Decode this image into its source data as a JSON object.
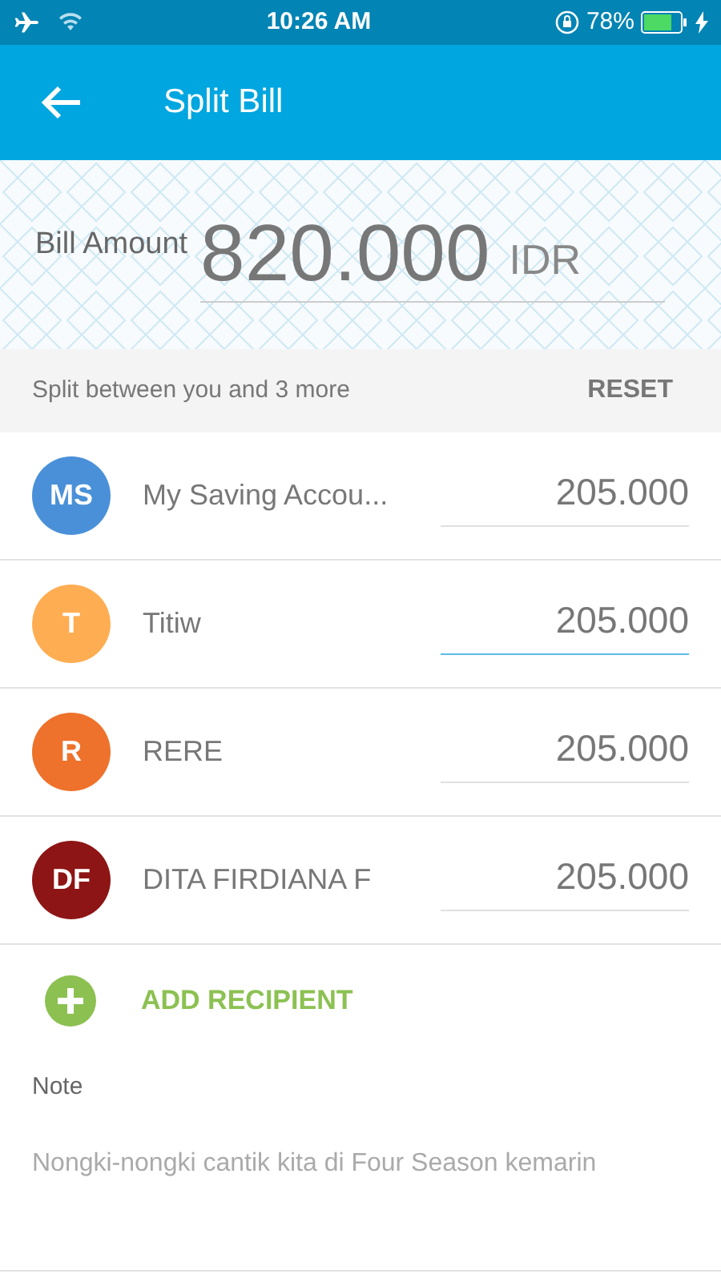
{
  "status_bar": {
    "time": "10:26 AM",
    "battery": "78%"
  },
  "header": {
    "title": "Split Bill"
  },
  "bill": {
    "label": "Bill Amount",
    "amount": "820.000",
    "currency": "IDR"
  },
  "split": {
    "summary": "Split between you and 3 more",
    "reset": "RESET"
  },
  "recipients": [
    {
      "initials": "MS",
      "name": "My Saving Accou...",
      "amount": "205.000",
      "color": "#4a90d9",
      "focused": false
    },
    {
      "initials": "T",
      "name": "Titiw",
      "amount": "205.000",
      "color": "#ffad52",
      "focused": true
    },
    {
      "initials": "R",
      "name": "RERE",
      "amount": "205.000",
      "color": "#ee722b",
      "focused": false
    },
    {
      "initials": "DF",
      "name": "DITA FIRDIANA F",
      "amount": "205.000",
      "color": "#8e1515",
      "focused": false
    }
  ],
  "add_recipient": {
    "label": "ADD RECIPIENT"
  },
  "note": {
    "label": "Note",
    "value": "Nongki-nongki cantik kita di Four Season kemarin"
  }
}
